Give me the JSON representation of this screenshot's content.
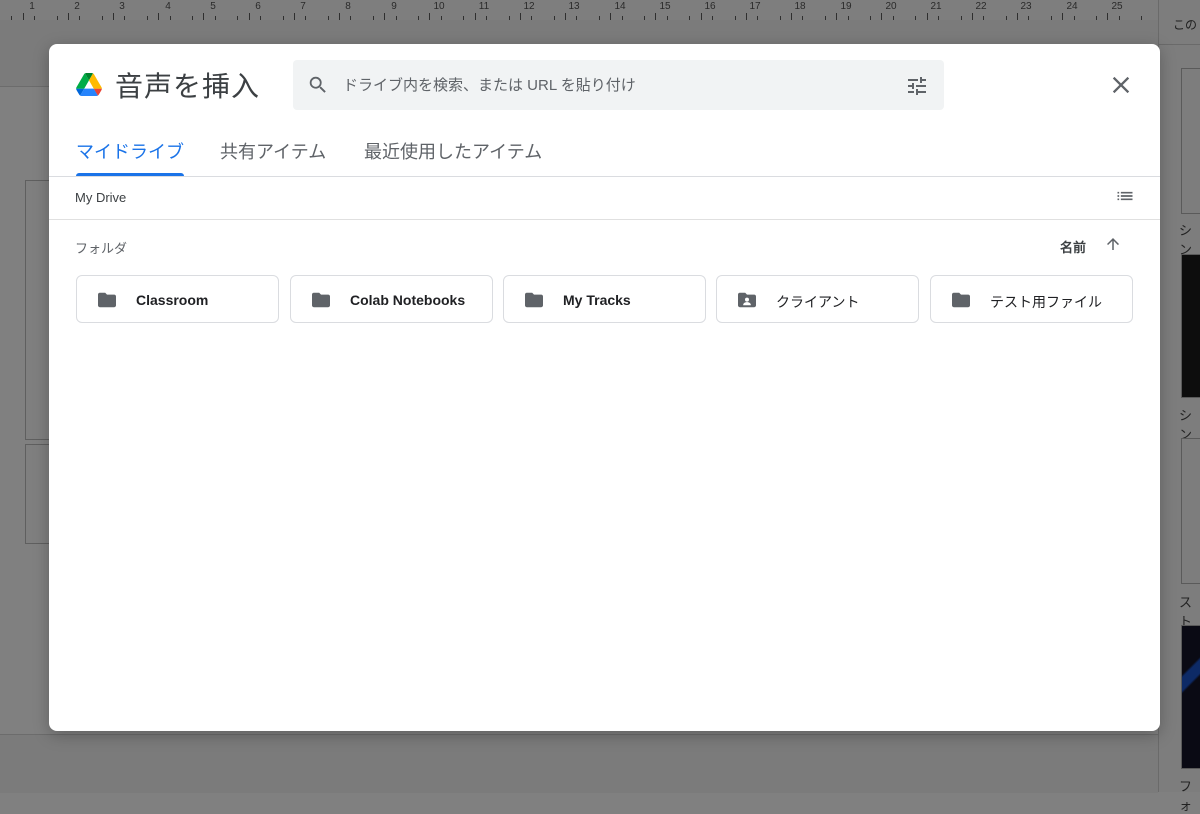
{
  "background": {
    "ruler_numbers": [
      "1",
      "2",
      "3",
      "4",
      "5",
      "6",
      "7",
      "8",
      "9",
      "10",
      "11",
      "12",
      "13",
      "14",
      "15",
      "16",
      "17",
      "18",
      "19",
      "20",
      "21",
      "22",
      "23",
      "24",
      "25"
    ],
    "side_panel": {
      "header_text": "この",
      "labels": [
        "シン",
        "シン",
        "スト",
        "フォ"
      ]
    }
  },
  "dialog": {
    "title": "音声を挿入",
    "logo_icon": "google-drive-icon",
    "search": {
      "placeholder": "ドライブ内を検索、または URL を貼り付け",
      "value": ""
    },
    "tabs": [
      {
        "label": "マイドライブ",
        "active": true
      },
      {
        "label": "共有アイテム",
        "active": false
      },
      {
        "label": "最近使用したアイテム",
        "active": false
      }
    ],
    "breadcrumb": "My Drive",
    "section_label": "フォルダ",
    "sort": {
      "label": "名前",
      "direction": "ascending"
    },
    "folders": [
      {
        "name": "Classroom",
        "icon": "folder-icon"
      },
      {
        "name": "Colab Notebooks",
        "icon": "folder-icon"
      },
      {
        "name": "My Tracks",
        "icon": "folder-icon"
      },
      {
        "name": "クライアント",
        "icon": "shared-folder-icon"
      },
      {
        "name": "テスト用ファイル",
        "icon": "folder-icon"
      }
    ]
  },
  "colors": {
    "accent": "#1a73e8",
    "icon_gray": "#5f6368",
    "overlay": "#808080"
  }
}
